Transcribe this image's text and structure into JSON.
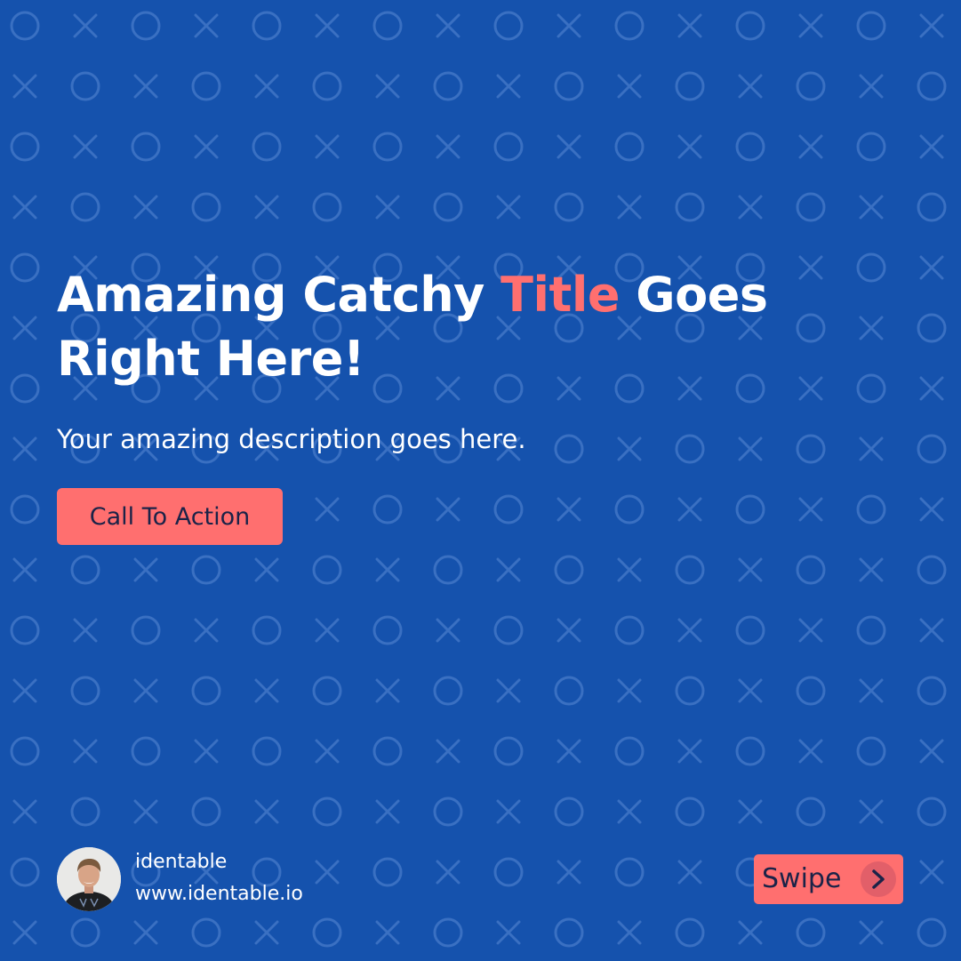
{
  "theme": {
    "background": "#1552ad",
    "accent": "#ff6f6f",
    "dark_text": "#1b2348",
    "text": "#ffffff"
  },
  "headline": {
    "before": "Amazing Catchy ",
    "accent_word": "Title",
    "after": " Goes Right Here!"
  },
  "description": "Your amazing description goes here.",
  "cta": {
    "label": "Call To Action"
  },
  "footer": {
    "brand_name": "identable",
    "website": "www.identable.io",
    "avatar_icon": "profile-photo",
    "swipe": {
      "label": "Swipe",
      "icon": "chevron-right-icon"
    }
  },
  "background_pattern": {
    "icons": [
      "circle-outline-icon",
      "x-mark-icon"
    ]
  }
}
